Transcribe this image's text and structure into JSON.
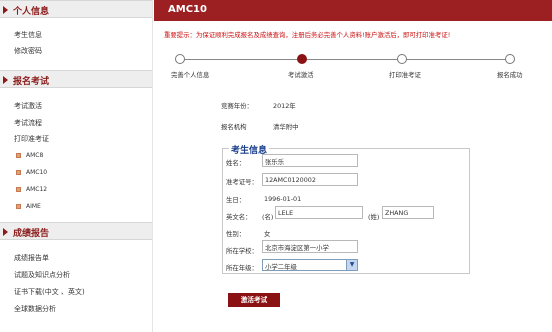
{
  "sidebar": {
    "sections": [
      {
        "title": "个人信息",
        "items": [
          "考生信息",
          "修改密码"
        ]
      },
      {
        "title": "报名考试",
        "items": [
          "考试激活",
          "考试流程",
          "打印准考证"
        ],
        "subitems": [
          "AMC8",
          "AMC10",
          "AMC12",
          "AIME"
        ]
      },
      {
        "title": "成绩报告",
        "items": [
          "成绩报告单",
          "试题及知识点分析",
          "证书下载(中文 、英文)",
          "全球数据分析"
        ]
      }
    ]
  },
  "header": {
    "title": "AMC10"
  },
  "notice": "重要提示：为保证顺利完成报名及成绩查询，注册后务必完善个人资料!账户激活后，即可打印准考证!",
  "steps": [
    "完善个人信息",
    "考试激活",
    "打印准考证",
    "报名成功"
  ],
  "active_step_index": 1,
  "info": {
    "year_label": "竞赛年份：",
    "year_value": "2012年",
    "org_label": "报名机构",
    "org_value": "清华附中"
  },
  "candidate": {
    "legend": "考生信息",
    "name_label": "姓名：",
    "name_value": "张乐乐",
    "ticket_label": "准考证号：",
    "ticket_value": "12AMC0120002",
    "birth_label": "生日：",
    "birth_value": "1996-01-01",
    "en_label": "英文名：",
    "first_prefix": "(名)",
    "first_value": "LELE",
    "last_prefix": "(姓)",
    "last_value": "ZHANG",
    "gender_label": "性别：",
    "gender_value": "女",
    "school_label": "所在学校：",
    "school_value": "北京市海淀区第一小学",
    "grade_label": "所在年级：",
    "grade_value": "小学二年级"
  },
  "submit_label": "激活考试",
  "colors": {
    "brand": "#9c2021",
    "accent_blue": "#1a3f8a",
    "notice": "#cc1111"
  }
}
